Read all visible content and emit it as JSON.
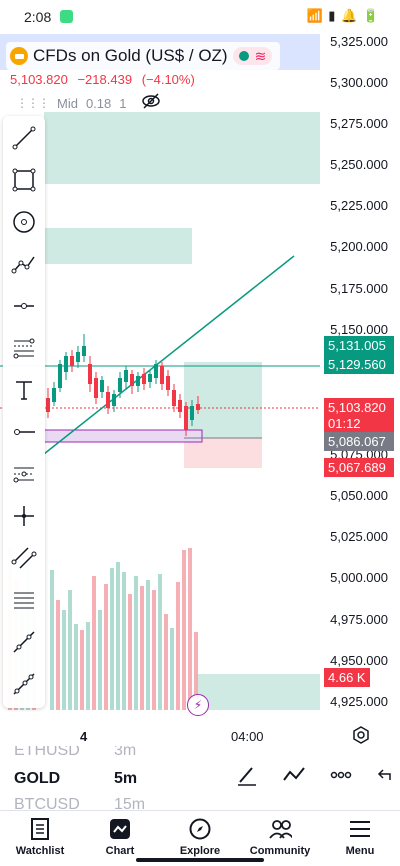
{
  "status_bar": {
    "time": "2:08",
    "icons_text": "📶 ▮ 🔔 🔋"
  },
  "symbol": {
    "title": "CFDs on Gold (US$ / OZ)",
    "icon": "gold-bar-icon"
  },
  "quote": {
    "price": "5,103.820",
    "change": "−218.439",
    "change_pct": "(−4.10%)"
  },
  "indicator": {
    "label": "Mid",
    "value": "0.18",
    "param": "1"
  },
  "price_axis": {
    "labels": [
      "5,325.000",
      "5,300.000",
      "5,275.000",
      "5,250.000",
      "5,225.000",
      "5,200.000",
      "5,175.000",
      "5,150.000",
      "5,025.000",
      "5,000.000",
      "4,975.000",
      "4,950.000",
      "4,925.000"
    ],
    "tags": {
      "tp": "5,131.005",
      "line": "5,129.560",
      "last_price": "5,103.820",
      "countdown": "01:12",
      "entry": "5,086.067",
      "sl": "5,067.689",
      "label_5075": "5,075.000",
      "label_5050": "5,050.000",
      "volume": "4.66 K"
    }
  },
  "time_axis": {
    "labels": [
      "4",
      "04:00"
    ]
  },
  "watchlist_strip": {
    "rows": [
      {
        "symbol": "ETHUSD",
        "interval": "3m"
      },
      {
        "symbol": "GOLD",
        "interval": "5m"
      },
      {
        "symbol": "BTCUSD",
        "interval": "15m"
      }
    ]
  },
  "nav": {
    "items": [
      {
        "label": "Watchlist",
        "icon": "watchlist-icon"
      },
      {
        "label": "Chart",
        "icon": "chart-icon"
      },
      {
        "label": "Explore",
        "icon": "compass-icon"
      },
      {
        "label": "Community",
        "icon": "community-icon"
      },
      {
        "label": "Menu",
        "icon": "menu-icon"
      }
    ]
  },
  "colors": {
    "up": "#089981",
    "down": "#f23645",
    "zone_fill": "#cfeae3",
    "sl_fill": "#fcdde0",
    "entry_tag": "#787b86",
    "purple": "#9c27b0"
  }
}
